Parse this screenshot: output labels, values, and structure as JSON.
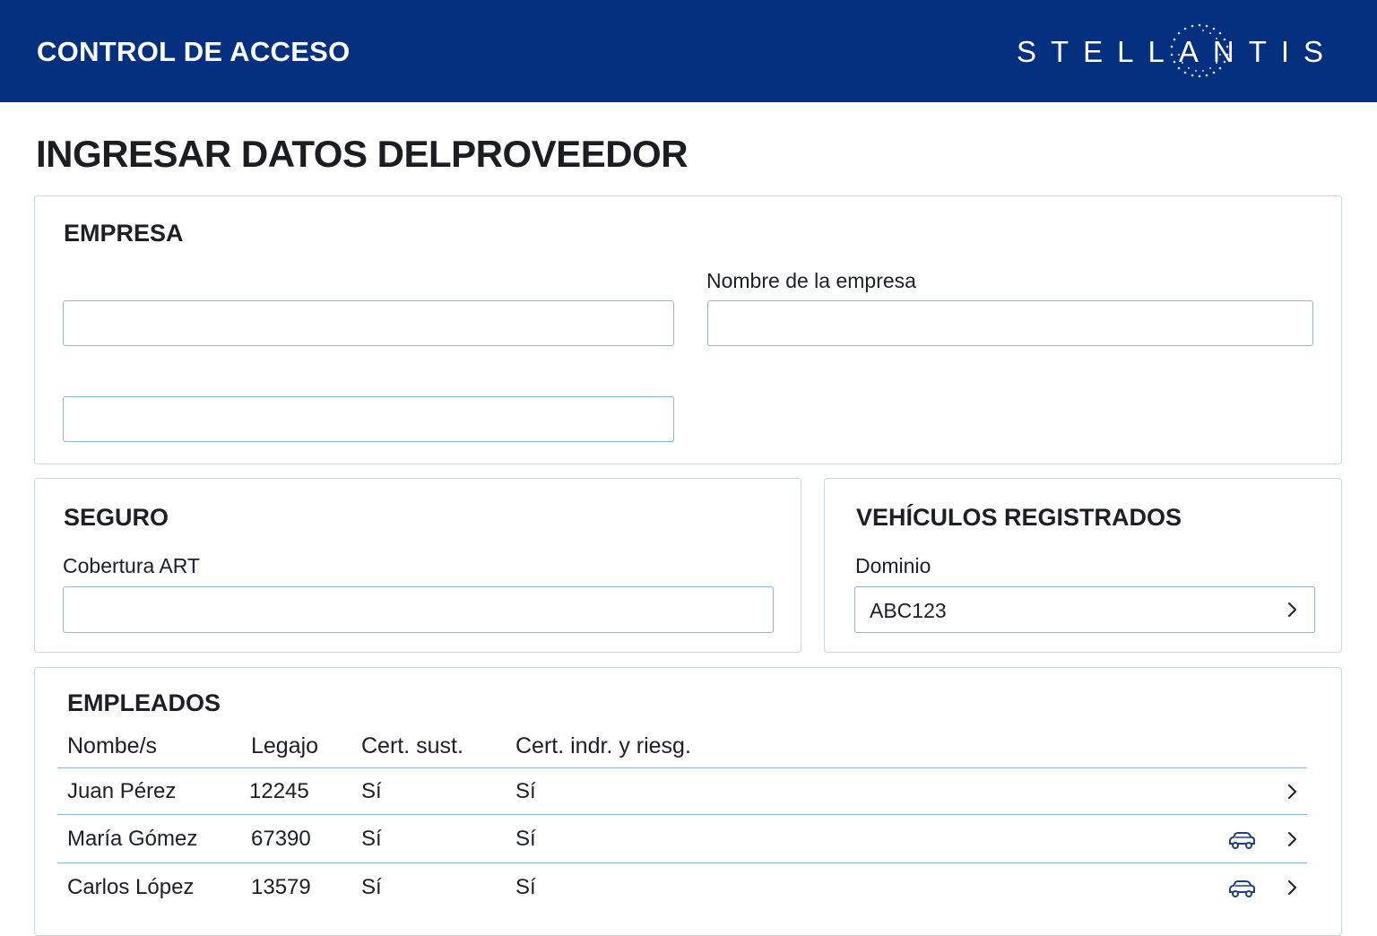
{
  "header": {
    "app_title": "CONTROL DE ACCESO",
    "brand": "STELLANTIS"
  },
  "page": {
    "title": "INGRESAR DATOS DELPROVEEDOR"
  },
  "empresa": {
    "title": "EMPRESA",
    "field1": {
      "value": ""
    },
    "field2": {
      "label": "Nombre de la empresa",
      "value": ""
    },
    "field3": {
      "value": ""
    }
  },
  "seguro": {
    "title": "SEGURO",
    "cobertura": {
      "label": "Cobertura ART",
      "value": ""
    }
  },
  "vehiculos": {
    "title": "VEHÍCULOS REGISTRADOS",
    "dominio": {
      "label": "Dominio",
      "value": "ABC123"
    }
  },
  "empleados": {
    "title": "EMPLEADOS",
    "columns": [
      "Nombe/s",
      "Legajo",
      "Cert. sust.",
      "Cert. indr. y riesg."
    ],
    "rows": [
      {
        "nombre": "Juan Pérez",
        "legajo": "12245",
        "cert_sust": "Sí",
        "cert_indr": "Sí",
        "has_vehicle": false
      },
      {
        "nombre": "María Gómez",
        "legajo": "67390",
        "cert_sust": "Sí",
        "cert_indr": "Sí",
        "has_vehicle": true
      },
      {
        "nombre": "Carlos López",
        "legajo": "13579",
        "cert_sust": "Sí",
        "cert_indr": "Sí",
        "has_vehicle": true
      }
    ]
  },
  "icons": {
    "chevron": "chevron-right-icon",
    "vehicle": "car-icon"
  },
  "colors": {
    "header_bg": "#05307f",
    "border": "#8fb3e4",
    "icon_blue": "#1f3f86"
  }
}
